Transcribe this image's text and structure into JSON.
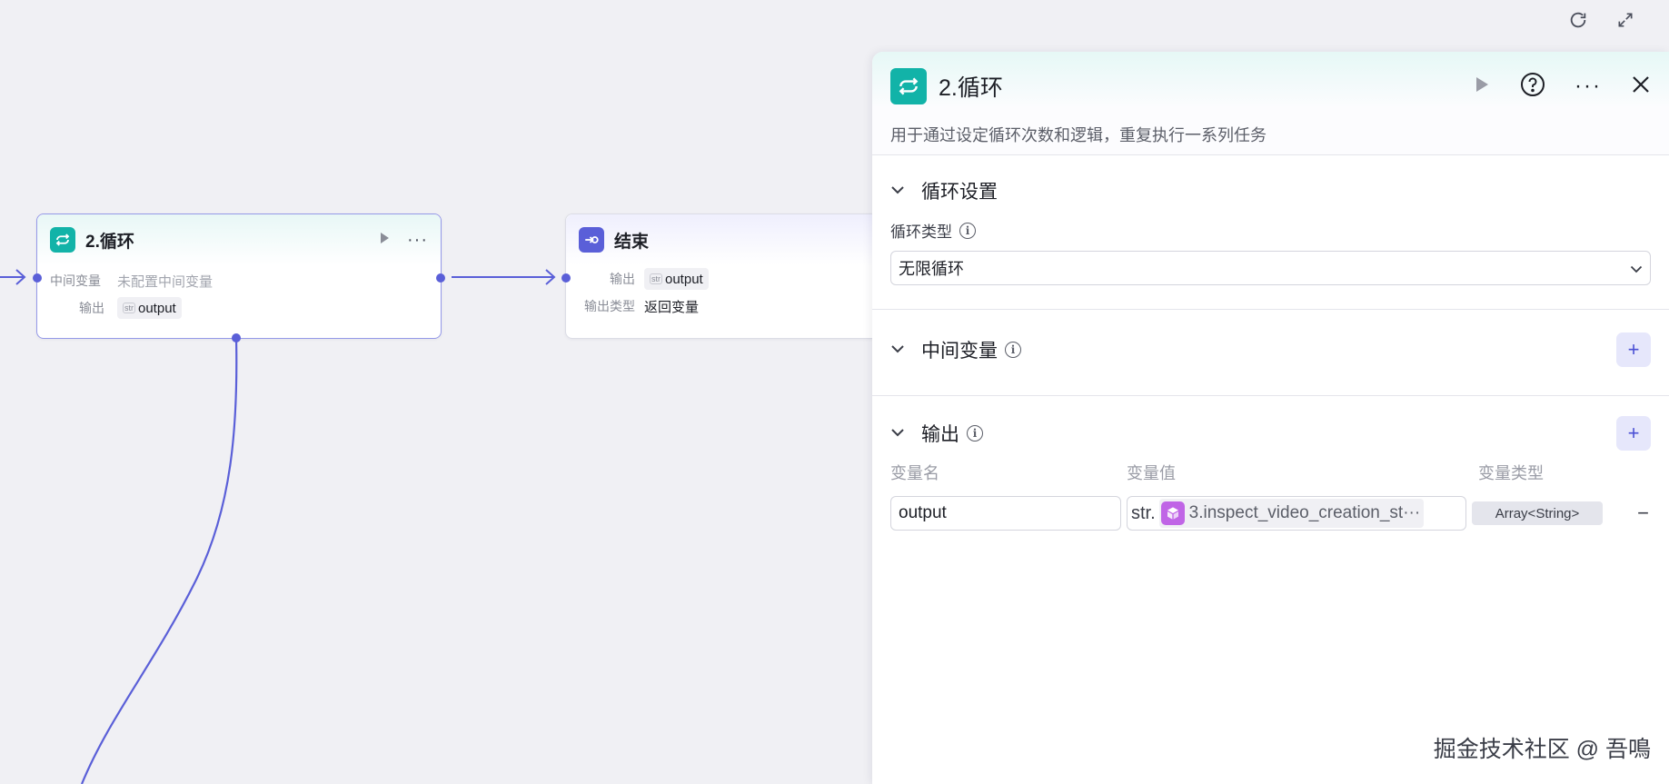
{
  "canvas": {
    "controls": [
      {
        "icon": "refresh-icon"
      },
      {
        "icon": "fullscreen-icon"
      }
    ],
    "edge_color": "#5a5fd8"
  },
  "loop_node": {
    "title": "2.循环",
    "icon": "loop-icon",
    "icon_color": "#12b3a8",
    "rows": {
      "intermediate_label": "中间变量",
      "intermediate_value": "未配置中间变量",
      "output_label": "输出",
      "output_tag_mini": "str",
      "output_tag": "output"
    }
  },
  "end_node": {
    "title": "结束",
    "icon": "end-icon",
    "icon_color": "#5a5fd8",
    "rows": {
      "output_label": "输出",
      "output_tag_mini": "str",
      "output_tag": "output",
      "output_type_label": "输出类型",
      "output_type_value": "返回变量"
    }
  },
  "panel": {
    "title": "2.循环",
    "icon": "loop-icon",
    "description": "用于通过设定循环次数和逻辑，重复执行一系列任务",
    "actions": [
      "run-icon",
      "help-icon",
      "more-icon",
      "close-icon"
    ],
    "loop_settings": {
      "title": "循环设置",
      "loop_type_label": "循环类型",
      "loop_type_value": "无限循环"
    },
    "intermediate": {
      "title": "中间变量",
      "add": "+"
    },
    "output": {
      "title": "输出",
      "add": "+",
      "columns": [
        "变量名",
        "变量值",
        "变量类型"
      ],
      "rows": [
        {
          "name": "output",
          "value_prefix": "str.",
          "value_ref": "3.inspect_video_creation_st···",
          "type": "Array<String>",
          "remove": "−"
        }
      ]
    }
  },
  "watermark": "掘金技术社区 @ 吾鳴"
}
